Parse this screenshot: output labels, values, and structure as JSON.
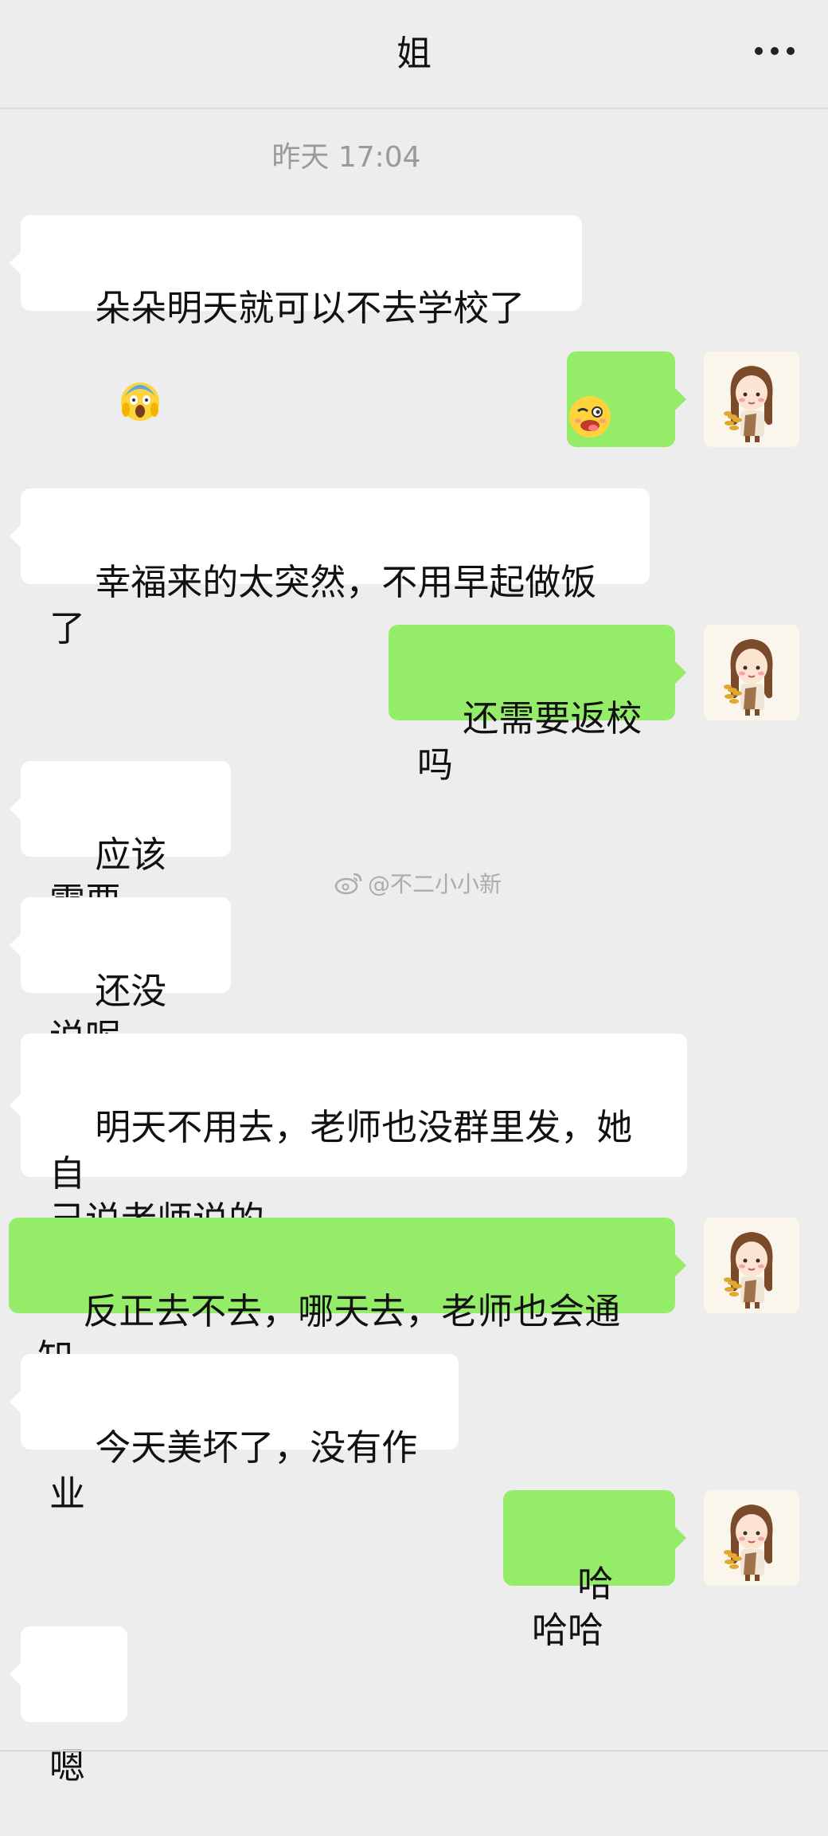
{
  "header": {
    "title": "姐",
    "more_icon": "more-horizontal-icon"
  },
  "timestamp": "昨天 17:04",
  "watermark": "@不二小小新",
  "messages": [
    {
      "side": "received",
      "text": "朵朵明天就可以不去学校了",
      "emoji": "screaming-face-emoji"
    },
    {
      "side": "sent",
      "text": "",
      "emoji": "yummy-face-emoji"
    },
    {
      "side": "received",
      "text": "幸福来的太突然，不用早起做饭了"
    },
    {
      "side": "sent",
      "text": "还需要返校吗"
    },
    {
      "side": "received",
      "text": "应该需要"
    },
    {
      "side": "received",
      "text": "还没说呢"
    },
    {
      "side": "received",
      "text": "明天不用去，老师也没群里发，她自\n己说老师说的"
    },
    {
      "side": "sent",
      "text": "反正去不去，哪天去，老师也会通知"
    },
    {
      "side": "received",
      "text": "今天美坏了，没有作业"
    },
    {
      "side": "sent",
      "text": "哈哈哈"
    },
    {
      "side": "received",
      "text": "嗯"
    }
  ],
  "colors": {
    "sent_bubble": "#95ec69",
    "received_bubble": "#ffffff",
    "background": "#ededed"
  }
}
